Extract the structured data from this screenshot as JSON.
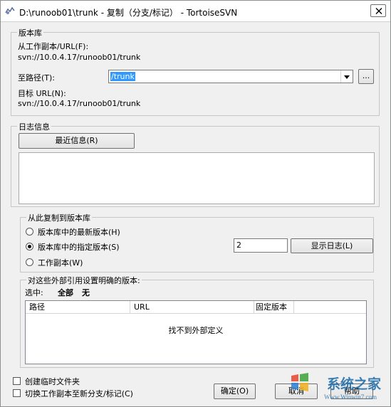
{
  "window": {
    "title": "D:\\runoob01\\trunk - 复制（分支/标记） - TortoiseSVN"
  },
  "repository": {
    "legend": "版本库",
    "from_label": "从工作副本/URL(F):",
    "from_value": "svn://10.0.4.17/runoob01/trunk",
    "to_label": "至路径(T):",
    "to_value": "/trunk",
    "browse_label": "...",
    "target_label": "目标 URL(N):",
    "target_value": "svn://10.0.4.17/runoob01/trunk"
  },
  "log": {
    "legend": "日志信息",
    "recent_label": "最近信息(R)",
    "message": ""
  },
  "copy_from": {
    "legend": "从此复制到版本库",
    "options": [
      {
        "label": "版本库中的最新版本(H)",
        "checked": false
      },
      {
        "label": "版本库中的指定版本(S)",
        "checked": true
      },
      {
        "label": "工作副本(W)",
        "checked": false
      }
    ],
    "revision_value": "2",
    "show_log_label": "显示日志(L)"
  },
  "externals": {
    "legend": "对这些外部引用设置明确的版本:",
    "select_label": "选中:",
    "select_all": "全部",
    "select_none": "无",
    "columns": [
      "路径",
      "URL",
      "固定版本"
    ],
    "empty_message": "找不到外部定义"
  },
  "options": {
    "temp_folder": "创建临时文件夹",
    "switch_wc": "切换工作副本至新分支/标记(C)"
  },
  "buttons": {
    "ok": "确定(O)",
    "cancel": "取消",
    "help": "帮助"
  },
  "watermark": {
    "brand": "系统之家",
    "url": "Www.Winwin7.com"
  }
}
